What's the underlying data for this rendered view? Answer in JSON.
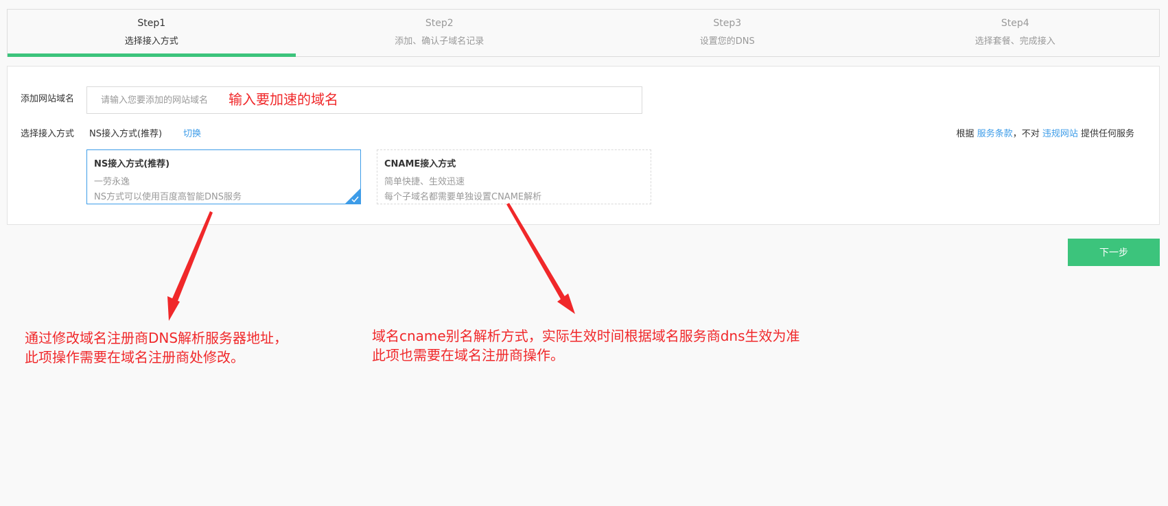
{
  "steps": [
    {
      "no": "Step1",
      "label": "选择接入方式",
      "active": true
    },
    {
      "no": "Step2",
      "label": "添加、确认子域名记录",
      "active": false
    },
    {
      "no": "Step3",
      "label": "设置您的DNS",
      "active": false
    },
    {
      "no": "Step4",
      "label": "选择套餐、完成接入",
      "active": false
    }
  ],
  "form": {
    "domain_label": "添加网站域名",
    "domain_placeholder": "请输入您要添加的网站域名",
    "domain_value": "",
    "method_label": "选择接入方式",
    "current_method": "NS接入方式(推荐)",
    "switch_link": "切换"
  },
  "terms": {
    "prefix": "根据 ",
    "terms_link": "服务条款",
    "middle": "，不对 ",
    "violation_link": "违规网站",
    "suffix": " 提供任何服务"
  },
  "options": [
    {
      "title": "NS接入方式(推荐)",
      "desc": "一劳永逸",
      "detail": "NS方式可以使用百度高智能DNS服务",
      "selected": true
    },
    {
      "title": "CNAME接入方式",
      "desc": "简单快捷、生效迅速",
      "detail": "每个子域名都需要单独设置CNAME解析",
      "selected": false
    }
  ],
  "next_button": "下一步",
  "annotations": {
    "input_hint": "输入要加速的域名",
    "ns_line1": "通过修改域名注册商DNS解析服务器地址，",
    "ns_line2": "此项操作需要在域名注册商处修改。",
    "cname_line1": "域名cname别名解析方式，实际生效时间根据域名服务商dns生效为准",
    "cname_line2": "此项也需要在域名注册商操作。"
  },
  "colors": {
    "accent_green": "#3cc47c",
    "link_blue": "#3d9ce8",
    "annotation_red": "#f0282a"
  }
}
